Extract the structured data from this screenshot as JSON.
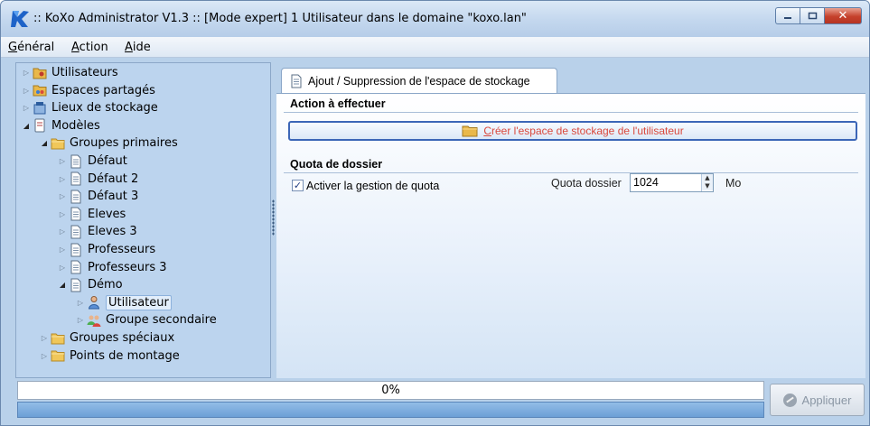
{
  "window": {
    "title": ":: KoXo Administrator V1.3 :: [Mode expert] 1 Utilisateur dans le domaine \"koxo.lan\"",
    "controls": {
      "close": "✕"
    }
  },
  "menu": [
    "Général",
    "Action",
    "Aide"
  ],
  "tree": [
    {
      "label": "Utilisateurs",
      "icon": "users-folder-icon",
      "level": 0,
      "expanded": false
    },
    {
      "label": "Espaces partagés",
      "icon": "shared-space-icon",
      "level": 0,
      "expanded": false
    },
    {
      "label": "Lieux de stockage",
      "icon": "storage-icon",
      "level": 0,
      "expanded": false
    },
    {
      "label": "Modèles",
      "icon": "templates-icon",
      "level": 0,
      "expanded": true
    },
    {
      "label": "Groupes primaires",
      "icon": "folder-icon",
      "level": 1,
      "expanded": true
    },
    {
      "label": "Défaut",
      "icon": "document-icon",
      "level": 2,
      "expanded": false
    },
    {
      "label": "Défaut 2",
      "icon": "document-icon",
      "level": 2,
      "expanded": false
    },
    {
      "label": "Défaut 3",
      "icon": "document-icon",
      "level": 2,
      "expanded": false
    },
    {
      "label": "Eleves",
      "icon": "document-icon",
      "level": 2,
      "expanded": false
    },
    {
      "label": "Eleves 3",
      "icon": "document-icon",
      "level": 2,
      "expanded": false
    },
    {
      "label": "Professeurs",
      "icon": "document-icon",
      "level": 2,
      "expanded": false
    },
    {
      "label": "Professeurs 3",
      "icon": "document-icon",
      "level": 2,
      "expanded": false
    },
    {
      "label": "Démo",
      "icon": "document-icon",
      "level": 2,
      "expanded": true
    },
    {
      "label": "Utilisateur",
      "icon": "user-icon",
      "level": 3,
      "expanded": false,
      "selected": true
    },
    {
      "label": "Groupe secondaire",
      "icon": "group-icon",
      "level": 3,
      "expanded": false
    },
    {
      "label": "Groupes spéciaux",
      "icon": "folder-icon",
      "level": 1,
      "expanded": false
    },
    {
      "label": "Points de montage",
      "icon": "folder-icon",
      "level": 1,
      "expanded": false
    }
  ],
  "tab": {
    "label": "Ajout / Suppression de l'espace de stockage"
  },
  "action_section": {
    "title": "Action à effectuer",
    "button_label": "Créer l'espace de stockage de l'utilisateur"
  },
  "quota_section": {
    "title": "Quota de dossier",
    "checkbox_label": "Activer la gestion de quota",
    "checkbox_checked": true,
    "quota_label": "Quota dossier",
    "quota_value": "1024",
    "quota_unit": "Mo"
  },
  "progress": {
    "text": "0%",
    "value": 0
  },
  "apply_button": {
    "label": "Appliquer",
    "enabled": false
  },
  "colors": {
    "accent": "#3c66b7",
    "action_text": "#d9483c",
    "tree_background": "#bcd4ee"
  }
}
